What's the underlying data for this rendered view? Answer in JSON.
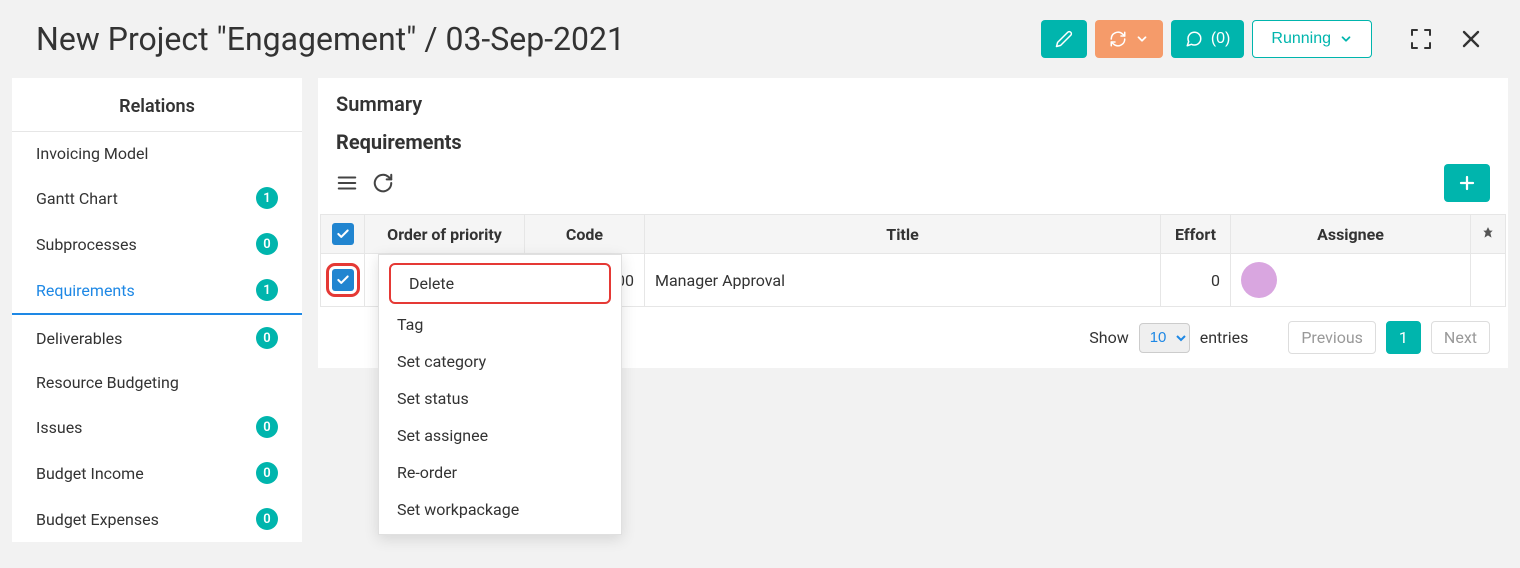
{
  "header": {
    "title": "New Project \"Engagement\" / 03-Sep-2021",
    "comments_label": "(0)",
    "status_label": "Running"
  },
  "sidebar": {
    "title": "Relations",
    "items": [
      {
        "label": "Invoicing Model",
        "count": null
      },
      {
        "label": "Gantt Chart",
        "count": "1"
      },
      {
        "label": "Subprocesses",
        "count": "0"
      },
      {
        "label": "Requirements",
        "count": "1",
        "active": true
      },
      {
        "label": "Deliverables",
        "count": "0"
      },
      {
        "label": "Resource Budgeting",
        "count": null
      },
      {
        "label": "Issues",
        "count": "0"
      },
      {
        "label": "Budget Income",
        "count": "0"
      },
      {
        "label": "Budget Expenses",
        "count": "0"
      }
    ]
  },
  "main": {
    "summary_label": "Summary",
    "section_label": "Requirements",
    "columns": {
      "priority": "Order of priority",
      "code": "Code",
      "title": "Title",
      "effort": "Effort",
      "assignee": "Assignee"
    },
    "rows": [
      {
        "priority": "",
        "code_suffix": "000",
        "title": "Manager Approval",
        "effort": "0",
        "assignee_color": "#d9a6e0"
      }
    ],
    "pager": {
      "show_label": "Show",
      "entries_label": "entries",
      "page_size": "10",
      "prev_label": "Previous",
      "next_label": "Next",
      "current_page": "1"
    }
  },
  "context_menu": {
    "items": [
      "Delete",
      "Tag",
      "Set category",
      "Set status",
      "Set assignee",
      "Re-order",
      "Set workpackage"
    ]
  }
}
